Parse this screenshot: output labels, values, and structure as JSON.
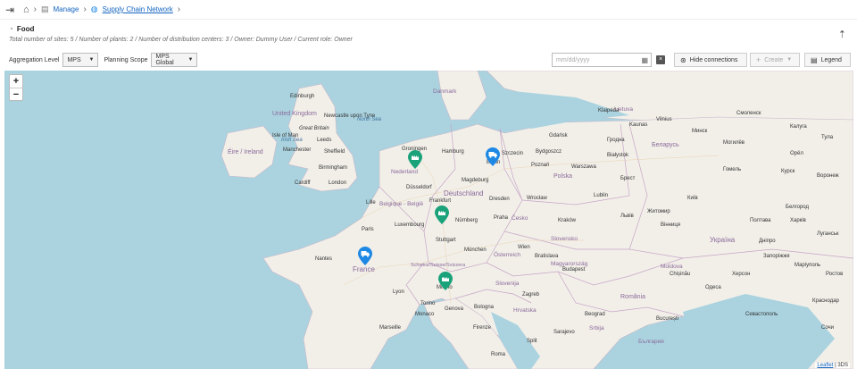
{
  "breadcrumb": {
    "items": [
      "Manage",
      "Supply Chain Network"
    ]
  },
  "header": {
    "title": "Food",
    "subtitle": "Total number of sites: 5 / Number of plants: 2 / Number of distribution centers: 3 / Owner: Dummy User / Current role: Owner"
  },
  "toolbar": {
    "aggregation_label": "Aggregation Level",
    "aggregation_value": "MPS",
    "scope_label": "Planning Scope",
    "scope_value": "MPS Global",
    "date_placeholder": "mm/dd/yyyy",
    "hide_connections_label": "Hide connections",
    "create_label": "Create",
    "legend_label": "Legend"
  },
  "map": {
    "zoom_in": "+",
    "zoom_out": "−",
    "attribution_link": "Leaflet",
    "attribution_sep": " | ",
    "attribution_src": "3DS",
    "countries": [
      "Danmark",
      "Nederland",
      "Deutschland",
      "Belgique - België",
      "France",
      "Polska",
      "Česko",
      "Österreich",
      "Schweiz/Suisse/Svizzera",
      "Slovensko",
      "Magyarország",
      "România",
      "Беларусь",
      "Україна",
      "Moldova",
      "Lietuva",
      "United Kingdom",
      "Éire / Ireland",
      "Slovenija",
      "Hrvatska",
      "Srbija",
      "България"
    ],
    "seas": [
      "North Sea",
      "Irish Sea"
    ],
    "cities": [
      "Edinburgh",
      "Newcastle upon Tyne",
      "Great Britain",
      "Isle of Man",
      "Leeds",
      "Manchester",
      "Sheffield",
      "Birmingham",
      "Cardiff",
      "London",
      "Groningen",
      "Hamburg",
      "Szczecin",
      "Berlin",
      "Poznań",
      "Bydgoszcz",
      "Gdańsk",
      "Warszawa",
      "Białystok",
      "Гродна",
      "Magdeburg",
      "Düsseldorf",
      "Lille",
      "Frankfurt",
      "Dresden",
      "Wrocław",
      "Lublin",
      "Nürnberg",
      "Stuttgart",
      "Luxembourg",
      "Paris",
      "Praha",
      "Kraków",
      "Львів",
      "Київ",
      "Nantes",
      "München",
      "Wien",
      "Bratislava",
      "Budapest",
      "Lyon",
      "Milano",
      "Torino",
      "Genova",
      "Bologna",
      "Monaco",
      "Marseille",
      "Zagreb",
      "Beograd",
      "București",
      "Chișinău",
      "Одеса",
      "Вінниця",
      "Житомир",
      "Херсон",
      "Маріуполь",
      "Kaunas",
      "Vilnius",
      "Klaipėda",
      "Брест",
      "Гомель",
      "Могилёв",
      "Минск",
      "Смоленск",
      "Калуга",
      "Тула",
      "Орёл",
      "Курск",
      "Воронеж",
      "Белгород",
      "Харків",
      "Полтава",
      "Дніпро",
      "Запоріжжя",
      "Луганськ",
      "Ростов",
      "Краснодар",
      "Севастополь",
      "Сочи",
      "Sarajevo",
      "Split",
      "Firenze",
      "Roma",
      "Kraków"
    ],
    "markers": [
      {
        "type": "plant",
        "color": "#1aa37a"
      },
      {
        "type": "distribution",
        "color": "#1e88e5"
      },
      {
        "type": "plant",
        "color": "#1aa37a"
      },
      {
        "type": "distribution",
        "color": "#1e88e5"
      },
      {
        "type": "plant",
        "color": "#1aa37a"
      }
    ]
  },
  "colors": {
    "water": "#aad3df",
    "land": "#f2efe9",
    "link": "#1565c0",
    "plant": "#1aa37a",
    "distribution": "#1e88e5"
  }
}
